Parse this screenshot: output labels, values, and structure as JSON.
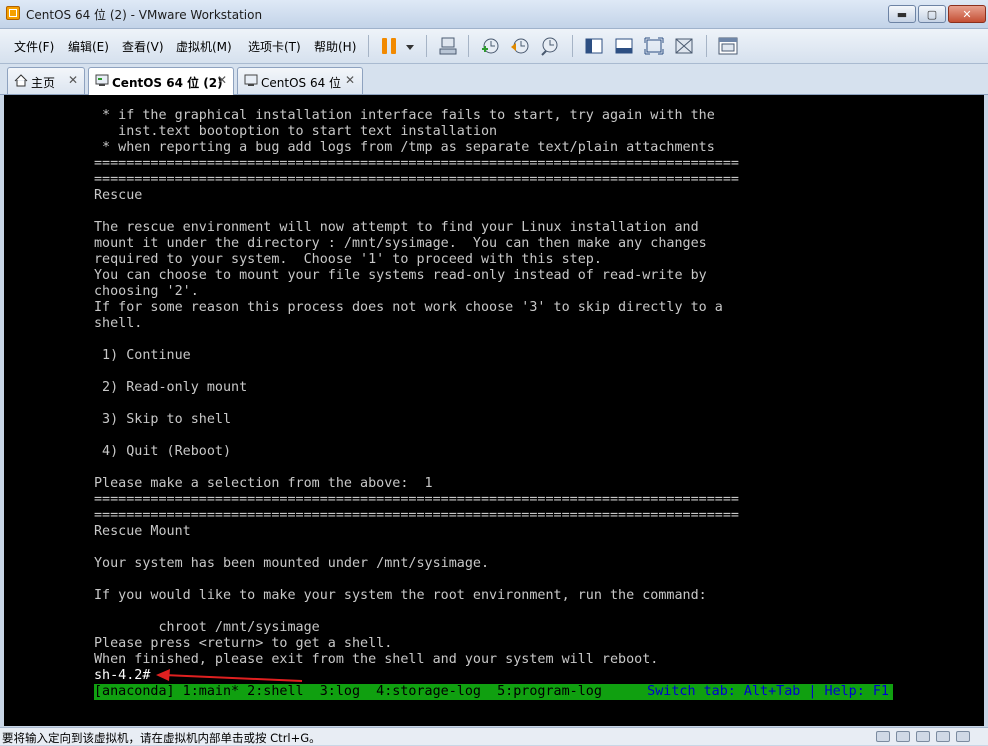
{
  "window": {
    "title": "CentOS 64 位 (2) - VMware Workstation",
    "controls": {
      "minimize": "▬",
      "maximize": "▢",
      "close": "✕"
    }
  },
  "menu": {
    "items": [
      "文件(F)",
      "编辑(E)",
      "查看(V)",
      "虚拟机(M)",
      "选项卡(T)",
      "帮助(H)"
    ]
  },
  "toolbar": {
    "pause_color": "#f28a00",
    "icons": [
      "send-keys-icon",
      "snapshot-icon",
      "revert-snapshot-icon",
      "snapshot-manager-icon",
      "show-library-icon",
      "thumbnail-icon",
      "fullscreen-icon",
      "unity-icon",
      "console-view-icon"
    ]
  },
  "tabs": [
    {
      "label": "主页",
      "active": false
    },
    {
      "label": "CentOS 64 位 (2)",
      "active": true
    },
    {
      "label": "CentOS 64 位",
      "active": false
    }
  ],
  "tab_close": "✕",
  "console": {
    "text": " * if the graphical installation interface fails to start, try again with the\n   inst.text bootoption to start text installation\n * when reporting a bug add logs from /tmp as separate text/plain attachments\n================================================================================\n================================================================================\nRescue\n\nThe rescue environment will now attempt to find your Linux installation and\nmount it under the directory : /mnt/sysimage.  You can then make any changes\nrequired to your system.  Choose '1' to proceed with this step.\nYou can choose to mount your file systems read-only instead of read-write by\nchoosing '2'.\nIf for some reason this process does not work choose '3' to skip directly to a\nshell.\n\n 1) Continue\n\n 2) Read-only mount\n\n 3) Skip to shell\n\n 4) Quit (Reboot)\n\nPlease make a selection from the above:  1\n================================================================================\n================================================================================\nRescue Mount\n\nYour system has been mounted under /mnt/sysimage.\n\nIf you would like to make your system the root environment, run the command:\n\n        chroot /mnt/sysimage\nPlease press <return> to get a shell.\nWhen finished, please exit from the shell and your system will reboot.",
    "prompt": "sh-4.2#",
    "status_tabs": "[anaconda] 1:main* 2:shell  3:log  4:storage-log  5:program-log",
    "status_help": "Switch tab: Alt+Tab | Help: F1",
    "status_bg": "#10a010",
    "annotation_arrow_color": "#e02020"
  },
  "statusbar": {
    "text": "要将输入定向到该虚拟机，请在虚拟机内部单击或按 Ctrl+G。"
  }
}
